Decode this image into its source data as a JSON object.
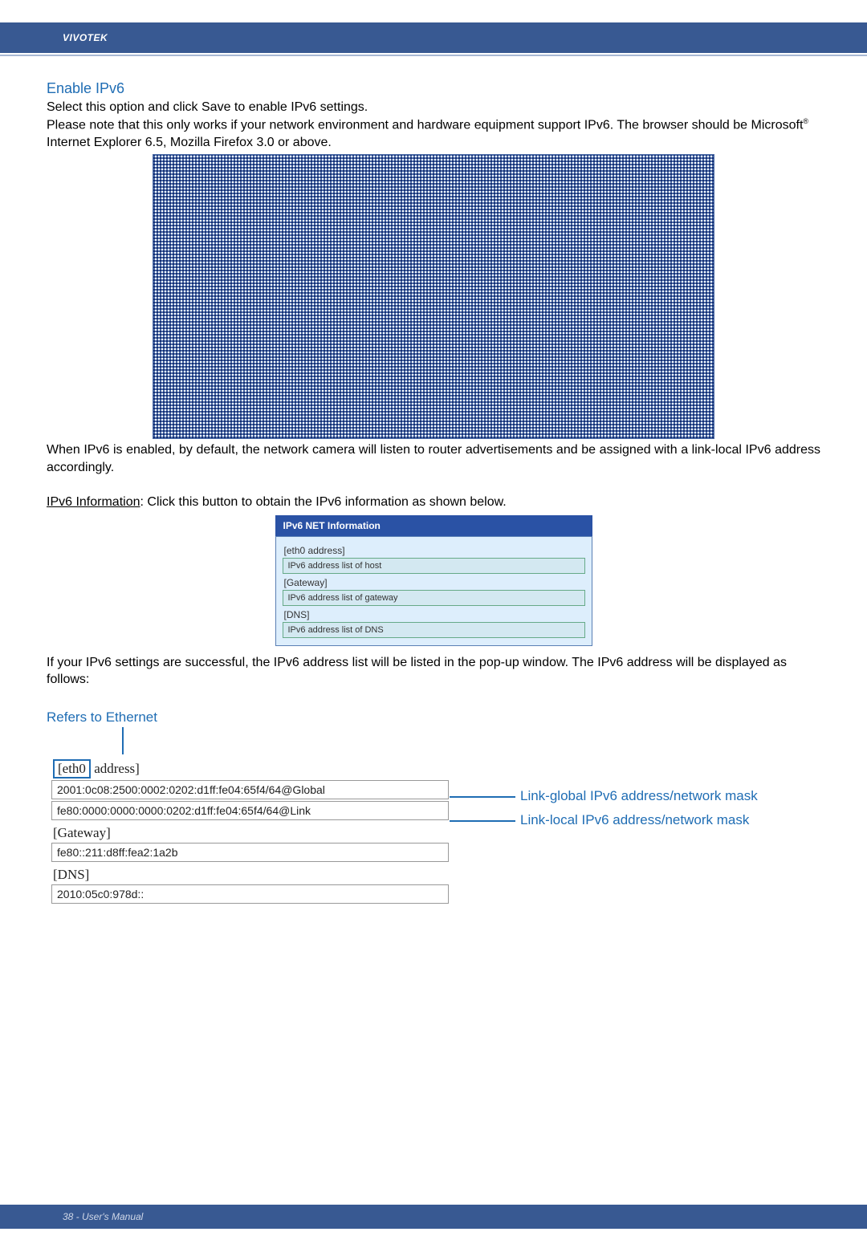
{
  "brand": "VIVOTEK",
  "section_title": "Enable IPv6",
  "para1_line1": "Select this option and click Save to enable IPv6 settings.",
  "para1_line2a": "Please note that this only works if your network environment and hardware equipment support IPv6. The browser should be Microsoft",
  "para1_line2b": " Internet Explorer 6.5, Mozilla Firefox 3.0 or above.",
  "reg_mark": "®",
  "para2": "When IPv6 is enabled, by default, the network camera will listen to router advertisements and be assigned with a link-local IPv6 address accordingly.",
  "ipv6_info_label": "IPv6 Information",
  "ipv6_info_rest": ": Click this button to obtain the IPv6 information as shown below.",
  "popup": {
    "title": "IPv6 NET Information",
    "eth_label": "[eth0 address]",
    "eth_box": "IPv6 address list of host",
    "gw_label": "[Gateway]",
    "gw_box": "IPv6 address list of gateway",
    "dns_label": "[DNS]",
    "dns_box": "IPv6 address list of DNS"
  },
  "para3": "If your IPv6 settings are successful, the IPv6 address list will be listed in the pop-up window. The IPv6 address will be displayed as follows:",
  "refers_to_ethernet": "Refers to Ethernet",
  "eth_bracket_open": "[eth0",
  "eth_bracket_close": " address]",
  "addr_global": "2001:0c08:2500:0002:0202:d1ff:fe04:65f4/64@Global",
  "addr_link": "fe80:0000:0000:0000:0202:d1ff:fe04:65f4/64@Link",
  "gateway_label": "[Gateway]",
  "gateway_value": "fe80::211:d8ff:fea2:1a2b",
  "dns_label": "[DNS]",
  "dns_value": "2010:05c0:978d::",
  "ann_global": "Link-global IPv6 address/network mask",
  "ann_local": "Link-local IPv6 address/network mask",
  "footer": "38 - User's Manual"
}
